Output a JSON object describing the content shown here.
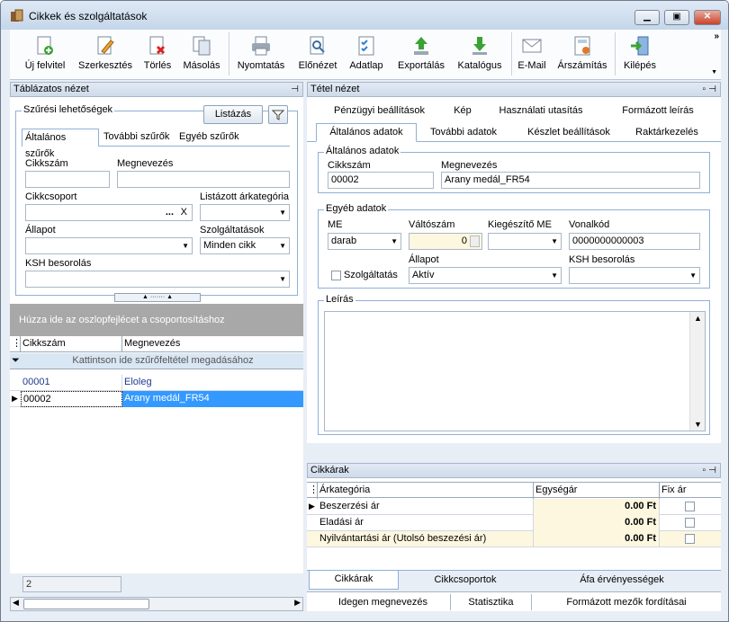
{
  "window": {
    "title": "Cikkek és szolgáltatások",
    "controls": [
      "minimize-icon",
      "maximize-icon",
      "close-icon"
    ]
  },
  "toolbar": {
    "items": [
      {
        "label": "Új felvitel",
        "icon": "new-item-icon"
      },
      {
        "label": "Szerkesztés",
        "icon": "edit-icon"
      },
      {
        "label": "Törlés",
        "icon": "delete-icon"
      },
      {
        "label": "Másolás",
        "icon": "copy-icon"
      },
      {
        "label": "Nyomtatás",
        "icon": "print-icon"
      },
      {
        "label": "Előnézet",
        "icon": "preview-icon"
      },
      {
        "label": "Adatlap",
        "icon": "datasheet-icon"
      },
      {
        "label": "Exportálás",
        "icon": "export-icon"
      },
      {
        "label": "Katalógus",
        "icon": "catalog-icon"
      },
      {
        "label": "E-Mail",
        "icon": "email-icon"
      },
      {
        "label": "Árszámítás",
        "icon": "price-calc-icon"
      },
      {
        "label": "Kilépés",
        "icon": "exit-icon"
      }
    ],
    "overflow": "»"
  },
  "left": {
    "pane_title": "Táblázatos nézet",
    "filter": {
      "legend": "Szűrési lehetőségek",
      "list_button": "Listázás",
      "tabs": [
        "Általános szűrők",
        "További szűrők",
        "Egyéb szűrők"
      ],
      "labels": {
        "cikkszam": "Cikkszám",
        "megnevezes": "Megnevezés",
        "cikkcsoport": "Cikkcsoport",
        "arkategoria": "Listázott árkategória",
        "allapot": "Állapot",
        "szolgaltatasok": "Szolgáltatások",
        "ksh": "KSH besorolás"
      },
      "values": {
        "cikkszam": "",
        "megnevezes": "",
        "cikkcsoport": "",
        "arkategoria": "",
        "allapot": "",
        "szolgaltatasok": "Minden cikk",
        "ksh": ""
      },
      "ellipsis": "...",
      "clear": "X"
    },
    "group_hint": "Húzza ide az oszlopfejlécet a csoportosításhoz",
    "grid": {
      "columns": [
        "Cikkszám",
        "Megnevezés"
      ],
      "filter_hint": "Kattintson ide szűrőfeltétel megadásához",
      "rows": [
        {
          "code": "00001",
          "name": "Eloleg",
          "selected": false
        },
        {
          "code": "00002",
          "name": "Arany medál_FR54",
          "selected": true
        }
      ]
    },
    "footer_count": "2"
  },
  "right": {
    "pane_title": "Tétel nézet",
    "tabs_row1": [
      "Pénzügyi beállítások",
      "Kép",
      "Használati utasítás",
      "Formázott leírás"
    ],
    "tabs_row2": [
      "Általános adatok",
      "További adatok",
      "Készlet beállítások",
      "Raktárkezelés"
    ],
    "general": {
      "legend": "Általános adatok",
      "cikkszam_label": "Cikkszám",
      "cikkszam": "00002",
      "megnevezes_label": "Megnevezés",
      "megnevezes": "Arany medál_FR54"
    },
    "other": {
      "legend": "Egyéb adatok",
      "me_label": "ME",
      "me": "darab",
      "valtoszam_label": "Váltószám",
      "valtoszam": "0",
      "kiegeszito_label": "Kiegészítő ME",
      "kiegeszito": "",
      "vonalkod_label": "Vonalkód",
      "vonalkod": "0000000000003",
      "szolg_label": "Szolgáltatás",
      "allapot_label": "Állapot",
      "allapot": "Aktív",
      "ksh_label": "KSH besorolás",
      "ksh": ""
    },
    "leiras_label": "Leírás",
    "prices": {
      "pane_title": "Cikkárak",
      "columns": [
        "Árkategória",
        "Egységár",
        "Fix ár"
      ],
      "rows": [
        {
          "name": "Beszerzési ár",
          "price": "0.00 Ft"
        },
        {
          "name": "Eladási ár",
          "price": "0.00 Ft"
        },
        {
          "name": "Nyilvántartási ár (Utolsó beszezési ár)",
          "price": "0.00 Ft"
        }
      ]
    },
    "bottom_tabs1": [
      "Cikkárak",
      "Cikkcsoportok",
      "Áfa érvényességek"
    ],
    "bottom_tabs2": [
      "Idegen megnevezés",
      "Statisztika",
      "Formázott mezők fordításai"
    ]
  }
}
